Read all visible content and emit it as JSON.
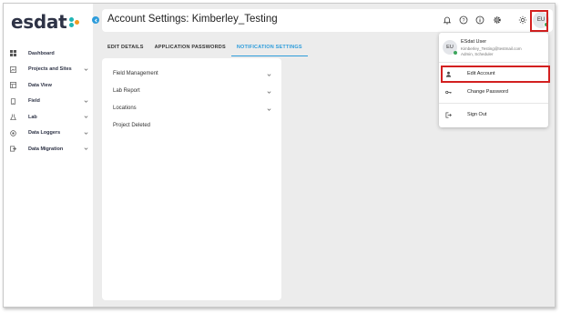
{
  "app": {
    "logo_text": "esdat"
  },
  "header": {
    "title": "Account Settings: Kimberley_Testing",
    "avatar_initials": "EU"
  },
  "sidebar": {
    "items": [
      {
        "label": "Dashboard",
        "icon": "dashboard-icon",
        "has_chevron": false
      },
      {
        "label": "Projects and Sites",
        "icon": "projects-icon",
        "has_chevron": true
      },
      {
        "label": "Data View",
        "icon": "data-view-icon",
        "has_chevron": false
      },
      {
        "label": "Field",
        "icon": "field-icon",
        "has_chevron": true
      },
      {
        "label": "Lab",
        "icon": "lab-icon",
        "has_chevron": true
      },
      {
        "label": "Data Loggers",
        "icon": "data-loggers-icon",
        "has_chevron": true
      },
      {
        "label": "Data Migration",
        "icon": "data-migration-icon",
        "has_chevron": true
      }
    ]
  },
  "tabs": [
    {
      "label": "EDIT DETAILS",
      "active": false
    },
    {
      "label": "APPLICATION PASSWORDS",
      "active": false
    },
    {
      "label": "NOTIFICATION SETTINGS",
      "active": true
    }
  ],
  "notifications": {
    "items": [
      {
        "label": "Field Management",
        "expandable": true
      },
      {
        "label": "Lab Report",
        "expandable": true
      },
      {
        "label": "Locations",
        "expandable": true
      },
      {
        "label": "Project Deleted",
        "expandable": false
      }
    ]
  },
  "user_menu": {
    "avatar_initials": "EU",
    "name": "ESdat User",
    "email": "Kimberley_Testing@testmail.com",
    "role": "Admin, Scheduler",
    "items": [
      {
        "label": "Edit Account",
        "icon": "user-icon"
      },
      {
        "label": "Change Password",
        "icon": "key-icon"
      },
      {
        "label": "Sign Out",
        "icon": "sign-out-icon"
      }
    ]
  },
  "colors": {
    "accent": "#2d9cdb",
    "highlight": "#d32020",
    "online": "#3ca55c",
    "logo_teal": "#1fb5b5",
    "logo_orange": "#f29a22"
  }
}
